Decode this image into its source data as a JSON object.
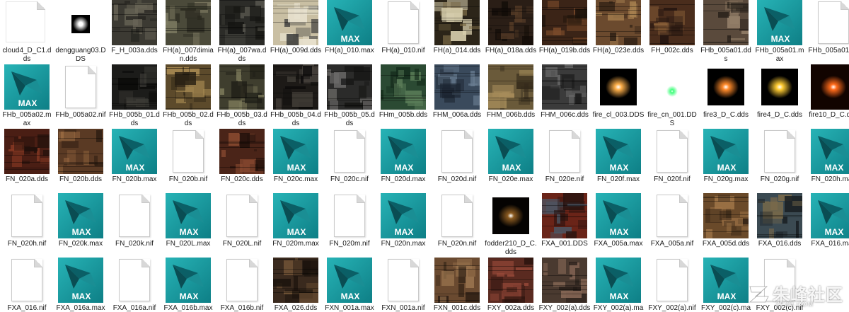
{
  "explorer": {
    "files": [
      {
        "name": "cloud4_D_C1.dds",
        "kind": "blank"
      },
      {
        "name": "dengguang03.DDS",
        "kind": "glow",
        "color": "#ffffff",
        "bg": "#ffffff"
      },
      {
        "name": "F_H_003a.dds",
        "kind": "tex",
        "palette": [
          "#3c3a33",
          "#6a6658",
          "#23221e"
        ]
      },
      {
        "name": "FH(a)_007dimian.dds",
        "kind": "tex",
        "palette": [
          "#4b4a3a",
          "#7d7a62",
          "#2b2a20"
        ]
      },
      {
        "name": "FH(a)_007wa.dds",
        "kind": "tex",
        "palette": [
          "#2c2c28",
          "#55544c",
          "#151512"
        ]
      },
      {
        "name": "FH(a)_009d.dds",
        "kind": "tex",
        "palette": [
          "#c9bfa3",
          "#3a3a3a",
          "#e8e2cf"
        ]
      },
      {
        "name": "FH(a)_010.max",
        "kind": "max"
      },
      {
        "name": "FH(a)_010.nif",
        "kind": "doc"
      },
      {
        "name": "FH(a)_014.dds",
        "kind": "tex",
        "palette": [
          "#2c2519",
          "#d8cfae",
          "#7a6a45"
        ]
      },
      {
        "name": "FH(a)_018a.dds",
        "kind": "tex",
        "palette": [
          "#2a1e16",
          "#553b27",
          "#120c08"
        ]
      },
      {
        "name": "FH(a)_019b.dds",
        "kind": "tex",
        "palette": [
          "#3b2417",
          "#7a4a2a",
          "#1c120b"
        ]
      },
      {
        "name": "FH(a)_023e.dds",
        "kind": "tex",
        "palette": [
          "#6b4a2e",
          "#a7804f",
          "#2c1f14"
        ]
      },
      {
        "name": "FH_002c.dds",
        "kind": "tex",
        "palette": [
          "#4a2d1c",
          "#8a6038",
          "#231510"
        ]
      },
      {
        "name": "FHb_005a01.dds",
        "kind": "tex",
        "palette": [
          "#5a4a3c",
          "#927e68",
          "#2a231c"
        ]
      },
      {
        "name": "FHb_005a01.max",
        "kind": "max"
      },
      {
        "name": "FHb_005a01.nif",
        "kind": "doc"
      },
      {
        "name": "FHb_005a02.max",
        "kind": "max"
      },
      {
        "name": "FHb_005a02.nif",
        "kind": "doc"
      },
      {
        "name": "FHb_005b_01.dds",
        "kind": "tex",
        "palette": [
          "#1c1c1a",
          "#3e3d38",
          "#0b0b0a"
        ]
      },
      {
        "name": "FHb_005b_02.dds",
        "kind": "tex",
        "palette": [
          "#5c4a2b",
          "#a88a52",
          "#2a2114"
        ]
      },
      {
        "name": "FHb_005b_03.dds",
        "kind": "tex",
        "palette": [
          "#3f3e2e",
          "#7c7a5a",
          "#1d1c15"
        ]
      },
      {
        "name": "FHb_005b_04.dds",
        "kind": "tex",
        "palette": [
          "#1d1a17",
          "#45403a",
          "#0c0b0a"
        ]
      },
      {
        "name": "FHb_005b_05.dds",
        "kind": "tex",
        "palette": [
          "#2b2b2a",
          "#6d6c6a",
          "#141413"
        ]
      },
      {
        "name": "FHm_005b.dds",
        "kind": "tex",
        "palette": [
          "#2b4a33",
          "#5a7c58",
          "#132a1a"
        ]
      },
      {
        "name": "FHM_006a.dds",
        "kind": "tex",
        "palette": [
          "#3a4a5c",
          "#6a7e92",
          "#1b2430"
        ]
      },
      {
        "name": "FHM_006b.dds",
        "kind": "tex",
        "palette": [
          "#6a5a3a",
          "#a68c5a",
          "#33291a"
        ]
      },
      {
        "name": "FHM_006c.dds",
        "kind": "tex",
        "palette": [
          "#3b3b3b",
          "#6b6b6b",
          "#1c1c1c"
        ]
      },
      {
        "name": "fire_cl_003.DDS",
        "kind": "glow",
        "color": "#ffb04a",
        "bg": "#000000"
      },
      {
        "name": "fire_cn_001.DDS",
        "kind": "glow",
        "color": "#3dff7a",
        "bg": "#ffffff"
      },
      {
        "name": "fire3_D_C.dds",
        "kind": "glow",
        "color": "#ff8a2a",
        "bg": "#000000"
      },
      {
        "name": "fire4_D_C.dds",
        "kind": "glow",
        "color": "#ffcc33",
        "bg": "#000000"
      },
      {
        "name": "fire10_D_C.dds",
        "kind": "glow",
        "color": "#ff6a1a",
        "bg": "#120400"
      },
      {
        "name": "FN_020a.dds",
        "kind": "tex",
        "palette": [
          "#4a1e14",
          "#8a3a24",
          "#21100b"
        ]
      },
      {
        "name": "FN_020b.dds",
        "kind": "tex",
        "palette": [
          "#5a3a24",
          "#9a6a42",
          "#2a1b10"
        ]
      },
      {
        "name": "FN_020b.max",
        "kind": "max"
      },
      {
        "name": "FN_020b.nif",
        "kind": "doc"
      },
      {
        "name": "FN_020c.dds",
        "kind": "tex",
        "palette": [
          "#4a2418",
          "#8a4a30",
          "#23110b"
        ]
      },
      {
        "name": "FN_020c.max",
        "kind": "max"
      },
      {
        "name": "FN_020c.nif",
        "kind": "doc"
      },
      {
        "name": "FN_020d.max",
        "kind": "max"
      },
      {
        "name": "FN_020d.nif",
        "kind": "doc"
      },
      {
        "name": "FN_020e.max",
        "kind": "max"
      },
      {
        "name": "FN_020e.nif",
        "kind": "doc"
      },
      {
        "name": "FN_020f.max",
        "kind": "max"
      },
      {
        "name": "FN_020f.nif",
        "kind": "doc"
      },
      {
        "name": "FN_020g.max",
        "kind": "max"
      },
      {
        "name": "FN_020g.nif",
        "kind": "doc"
      },
      {
        "name": "FN_020h.max",
        "kind": "max"
      },
      {
        "name": "FN_020h.nif",
        "kind": "doc"
      },
      {
        "name": "FN_020k.max",
        "kind": "max"
      },
      {
        "name": "FN_020k.nif",
        "kind": "doc"
      },
      {
        "name": "FN_020L.max",
        "kind": "max"
      },
      {
        "name": "FN_020L.nif",
        "kind": "doc"
      },
      {
        "name": "FN_020m.max",
        "kind": "max"
      },
      {
        "name": "FN_020m.nif",
        "kind": "doc"
      },
      {
        "name": "FN_020n.max",
        "kind": "max"
      },
      {
        "name": "FN_020n.nif",
        "kind": "doc"
      },
      {
        "name": "fodder210_D_C.dds",
        "kind": "glow",
        "color": "#8a5a20",
        "bg": "#050302"
      },
      {
        "name": "FXA_001.DDS",
        "kind": "tex",
        "palette": [
          "#6a2418",
          "#4a5a6a",
          "#2a1410"
        ]
      },
      {
        "name": "FXA_005a.max",
        "kind": "max"
      },
      {
        "name": "FXA_005a.nif",
        "kind": "doc"
      },
      {
        "name": "FXA_005d.dds",
        "kind": "tex",
        "palette": [
          "#6a4a2a",
          "#a4784a",
          "#2e1f12"
        ]
      },
      {
        "name": "FXA_016.dds",
        "kind": "tex",
        "palette": [
          "#3b4a52",
          "#7a6a4a",
          "#1a2024"
        ]
      },
      {
        "name": "FXA_016.max",
        "kind": "max"
      },
      {
        "name": "FXA_016.nif",
        "kind": "doc"
      },
      {
        "name": "FXA_016a.max",
        "kind": "max"
      },
      {
        "name": "FXA_016a.nif",
        "kind": "doc"
      },
      {
        "name": "FXA_016b.max",
        "kind": "max"
      },
      {
        "name": "FXA_016b.nif",
        "kind": "doc"
      },
      {
        "name": "FXA_026.dds",
        "kind": "tex",
        "palette": [
          "#3a2a1e",
          "#7a5a3a",
          "#1a120c"
        ]
      },
      {
        "name": "FXN_001a.max",
        "kind": "max"
      },
      {
        "name": "FXN_001a.nif",
        "kind": "doc"
      },
      {
        "name": "FXN_001c.dds",
        "kind": "tex",
        "palette": [
          "#6a4a30",
          "#a07a52",
          "#2e1f14"
        ]
      },
      {
        "name": "FXY_002a.dds",
        "kind": "tex",
        "palette": [
          "#5a2a20",
          "#9a4a3a",
          "#2a130e"
        ]
      },
      {
        "name": "FXY_002(a).dds",
        "kind": "tex",
        "palette": [
          "#4a3a30",
          "#8a6a58",
          "#221a16"
        ]
      },
      {
        "name": "FXY_002(a).max",
        "kind": "max"
      },
      {
        "name": "FXY_002(a).nif",
        "kind": "doc"
      },
      {
        "name": "FXY_002(c).max",
        "kind": "max"
      },
      {
        "name": "FXY_002(c).nif",
        "kind": "doc"
      }
    ],
    "max_badge": "MAX",
    "watermark": {
      "text": "朱峰社区",
      "sub": "ZF3D.COM"
    }
  }
}
